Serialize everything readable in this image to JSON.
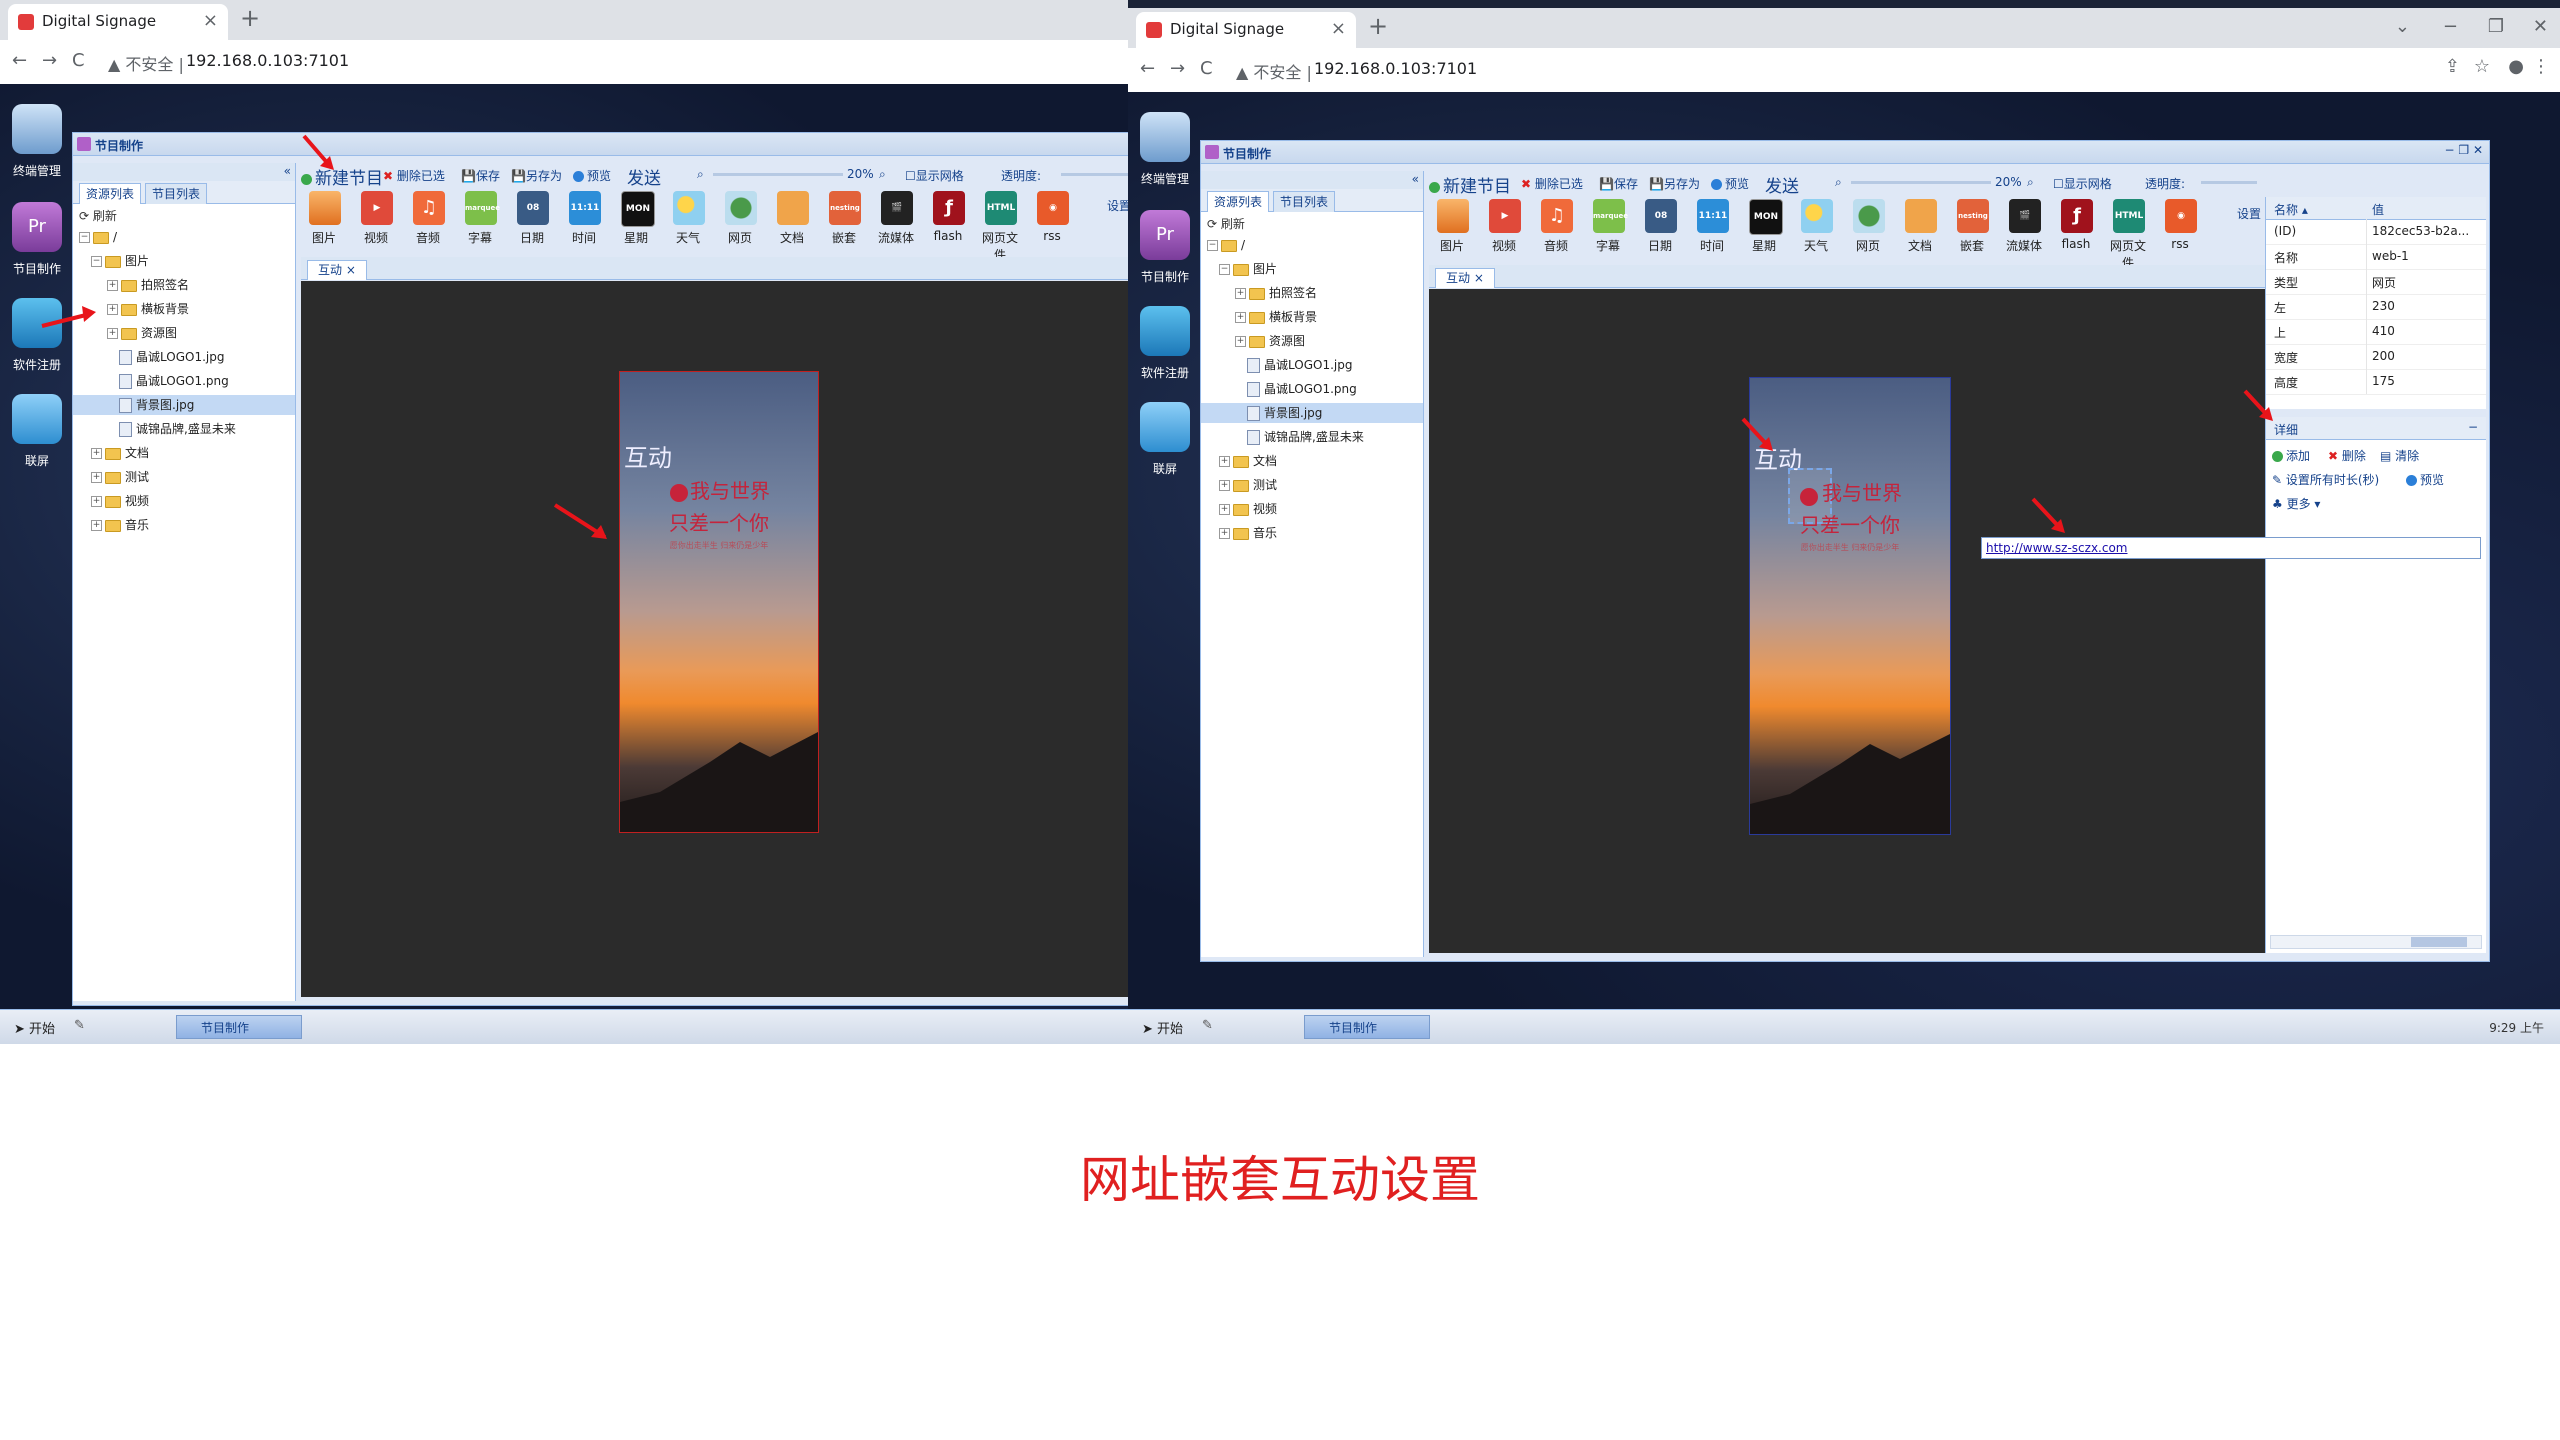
{
  "left_browser": {
    "tab_title": "Digital Signage",
    "tab_close": "×",
    "new_tab": "+",
    "nav_back": "←",
    "nav_forward": "→",
    "nav_reload": "C",
    "url_warning": "▲ 不安全 |",
    "url": "192.168.0.103:7101"
  },
  "right_browser": {
    "tab_title": "Digital Signage",
    "tab_close": "×",
    "new_tab": "+",
    "nav_back": "←",
    "nav_forward": "→",
    "nav_reload": "C",
    "url_warning": "▲ 不安全 |",
    "url": "192.168.0.103:7101",
    "clock": "9:29 上午"
  },
  "desktop_icons": [
    "终端管理",
    "节目制作",
    "软件注册",
    "联屏"
  ],
  "window_title": "节目制作",
  "panel_tabs": [
    "资源列表",
    "节目列表"
  ],
  "refresh": "刷新",
  "tree": {
    "root": "/",
    "images": "图片",
    "sub1": "拍照签名",
    "sub2": "横板背景",
    "sub3": "资源图",
    "file1": "晶诚LOGO1.jpg",
    "file2": "晶诚LOGO1.png",
    "file3": "背景图.jpg",
    "file4": "诚锦品牌,盛显未来",
    "doc": "文档",
    "test": "测试",
    "video": "视频",
    "music": "音乐"
  },
  "toolbar": {
    "new_program": "新建节目",
    "delete": "删除已选",
    "save": "保存",
    "save_as": "另存为",
    "preview": "预览",
    "send": "发送",
    "zoom": "20%",
    "grid": "显示网格",
    "opacity": "透明度:",
    "settings": "设置"
  },
  "ribbon": [
    "图片",
    "视频",
    "音频",
    "字幕",
    "日期",
    "时间",
    "星期",
    "天气",
    "网页",
    "文档",
    "嵌套",
    "流媒体",
    "flash",
    "网页文件",
    "rss"
  ],
  "ribbon_icon_text": {
    "date": "08",
    "time": "11:11",
    "week": "MON",
    "html": "HTML",
    "marquee": "marquee",
    "nesting": "nesting"
  },
  "doc_tab": "互动",
  "canvas": {
    "overlay_label": "互动",
    "slogan_line1": "我与世界",
    "slogan_line2": "只差一个你",
    "slogan_small": "愿你出走半生  归来仍是少年"
  },
  "properties": {
    "col_name": "名称 ▴",
    "col_value": "值",
    "rows": [
      {
        "k": "(ID)",
        "v": "182cec53-b2a..."
      },
      {
        "k": "名称",
        "v": "web-1"
      },
      {
        "k": "类型",
        "v": "网页"
      },
      {
        "k": "左",
        "v": "230"
      },
      {
        "k": "上",
        "v": "410"
      },
      {
        "k": "宽度",
        "v": "200"
      },
      {
        "k": "高度",
        "v": "175"
      }
    ]
  },
  "events": {
    "title": "详细",
    "collapse": "−",
    "add": "添加",
    "del": "删除",
    "clear": "清除",
    "set_duration": "设置所有时长(秒)",
    "preview": "预览",
    "more": "更多 ▾",
    "url": "http://www.sz-sczx.com"
  },
  "taskbar": {
    "start": "开始",
    "task": "节目制作"
  },
  "caption": "网址嵌套互动设置"
}
